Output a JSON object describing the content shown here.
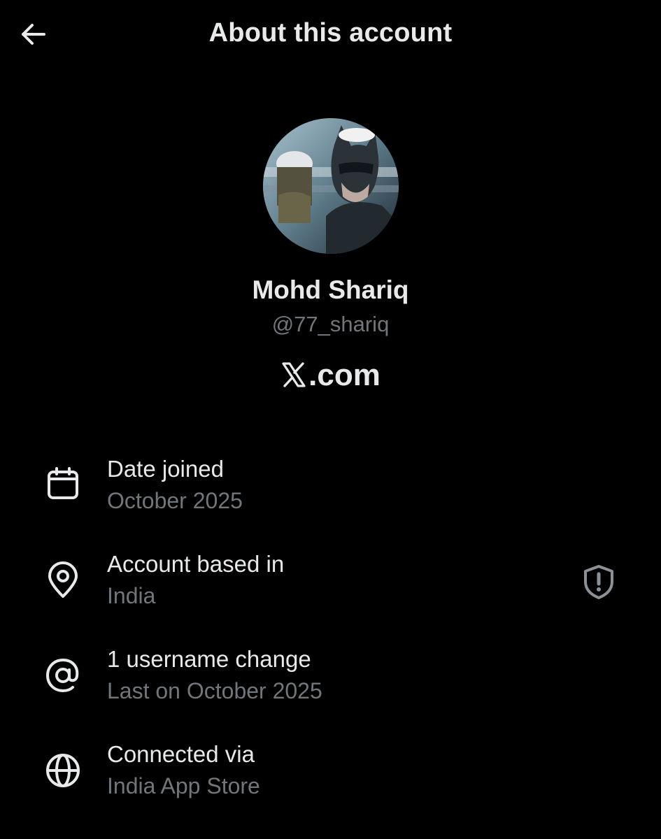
{
  "header": {
    "title": "About this account",
    "back_icon": "arrow-left-icon"
  },
  "profile": {
    "display_name": "Mohd Shariq",
    "handle": "@77_shariq",
    "site_text": ".com",
    "site_logo": "x-logo-icon"
  },
  "info_rows": [
    {
      "icon": "calendar-icon",
      "label": "Date joined",
      "value": "October 2025"
    },
    {
      "icon": "location-pin-icon",
      "label": "Account based in",
      "value": "India",
      "trailing_icon": "shield-alert-icon"
    },
    {
      "icon": "at-sign-icon",
      "label": "1 username change",
      "value": "Last on October 2025"
    },
    {
      "icon": "globe-icon",
      "label": "Connected via",
      "value": "India App Store"
    }
  ],
  "colors": {
    "background": "#000000",
    "primary_text": "#e7e9ea",
    "secondary_text": "#71767b"
  }
}
